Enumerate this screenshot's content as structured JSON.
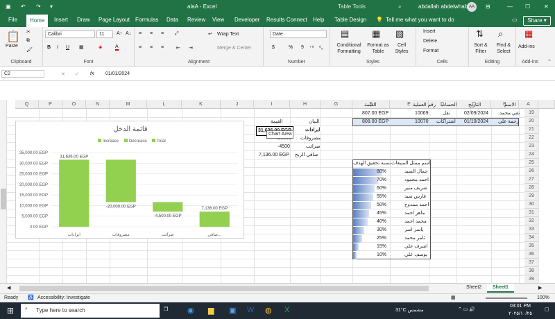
{
  "titlebar": {
    "file_name": "alaA",
    "app_name": "Excel",
    "context_tab": "Table Tools",
    "user_name": "abdallah abdelwhab",
    "user_initials": "AA",
    "save_label": "Save"
  },
  "tabs": [
    "File",
    "Home",
    "Insert",
    "Draw",
    "Page Layout",
    "Formulas",
    "Data",
    "Review",
    "View",
    "Developer",
    "Results Connect",
    "Help",
    "Table Design"
  ],
  "tell_me": "Tell me what you want to do",
  "share_label": "Share",
  "ribbon": {
    "clipboard": {
      "label": "Clipboard",
      "paste": "Paste"
    },
    "font": {
      "label": "Font",
      "name": "Calibri",
      "size": "11",
      "bold": "B",
      "italic": "I",
      "underline": "U"
    },
    "alignment": {
      "label": "Alignment",
      "wrap": "Wrap Text",
      "merge": "Merge & Center"
    },
    "number": {
      "label": "Number",
      "format": "Date",
      "currency": "$",
      "percent": "%",
      "comma": "9"
    },
    "styles": {
      "label": "Styles",
      "conditional": "Conditional Formatting",
      "format_table": "Format as Table",
      "cell_styles": "Cell Styles"
    },
    "cells": {
      "label": "Cells",
      "insert": "Insert",
      "delete": "Delete",
      "format": "Format"
    },
    "editing": {
      "label": "Editing",
      "sort": "Sort & Filter",
      "find": "Find & Select"
    },
    "addins": {
      "label": "Add-ins",
      "addins": "Add-ins"
    }
  },
  "formula_bar": {
    "name_box": "C2",
    "fx": "fx",
    "value": "01/01/2024"
  },
  "columns": [
    "Q",
    "P",
    "O",
    "N",
    "M",
    "L",
    "K",
    "J",
    "I",
    "H",
    "G",
    "F",
    "E",
    "D",
    "C",
    "B",
    "A"
  ],
  "rows": [
    "19",
    "20",
    "21",
    "22",
    "23",
    "24",
    "25",
    "26",
    "27",
    "28",
    "29",
    "30",
    "31",
    "32",
    "33",
    "34",
    "35",
    "36",
    "37",
    "38",
    "39"
  ],
  "table_header": {
    "name": "الاسم",
    "date": "التاريخ",
    "account": "الحساب",
    "op_no": "رقم العملية",
    "value": "القيمة"
  },
  "table_rows": [
    {
      "name": "تقي محمد",
      "date": "02/09/2024",
      "account": "نقل",
      "op_no": "10069",
      "value": "807.00 EGP"
    },
    {
      "name": "رحمة علي",
      "date": "01/10/2024",
      "account": "اشتراكات",
      "op_no": "10070",
      "value": "808.00 EGP"
    }
  ],
  "summary": {
    "header_item": "البيان",
    "header_value": "القيمة",
    "rows": [
      {
        "item": "ايرادات",
        "value": "31,636.00 EGP"
      },
      {
        "item": "مصروفات",
        "value": "-20000"
      },
      {
        "item": "ضرائب",
        "value": "-4500"
      },
      {
        "item": "صافي الربح",
        "value": "7,136.00 EGP"
      }
    ],
    "tooltip": "Chart Area"
  },
  "sales": {
    "header_name": "اسم ممثل المبيعات",
    "header_pct": "نسبة تحقيق الهدف",
    "rows": [
      {
        "name": "جمال السيد",
        "pct": "80%",
        "fill": 0.8
      },
      {
        "name": "احمد محمود",
        "pct": "70%",
        "fill": 0.7
      },
      {
        "name": "شريف منير",
        "pct": "60%",
        "fill": 0.6
      },
      {
        "name": "فارس سيد",
        "pct": "55%",
        "fill": 0.55
      },
      {
        "name": "احمد ممدوح",
        "pct": "50%",
        "fill": 0.5
      },
      {
        "name": "ماهر احمد",
        "pct": "45%",
        "fill": 0.45
      },
      {
        "name": "محمد احمد",
        "pct": "40%",
        "fill": 0.4
      },
      {
        "name": "ياسر اسر",
        "pct": "30%",
        "fill": 0.3
      },
      {
        "name": "ثامر محمد",
        "pct": "25%",
        "fill": 0.25
      },
      {
        "name": "اشرف علي",
        "pct": "15%",
        "fill": 0.15
      },
      {
        "name": "يوسف علي",
        "pct": "10%",
        "fill": 0.1
      }
    ]
  },
  "chart_data": {
    "type": "waterfall",
    "title": "قائمة الدخل",
    "legend": [
      "Increase",
      "Decrease",
      "Total"
    ],
    "legend_position": "top",
    "categories": [
      "ايرادات",
      "مصروفات",
      "ضرائب",
      "صافي..."
    ],
    "values": [
      31636,
      -20000,
      -4500,
      7136
    ],
    "data_labels": [
      "31,636.00 EGP",
      "-20,000.00 EGP",
      "-4,500.00 EGP",
      "7,136.00 EGP"
    ],
    "y_ticks": [
      "35,000.00 EGP",
      "30,000.00 EGP",
      "25,000.00 EGP",
      "20,000.00 EGP",
      "15,000.00 EGP",
      "10,000.00 EGP",
      "5,000.00 EGP",
      "0.00 EGP"
    ],
    "ylim": [
      0,
      35000
    ],
    "color": "#92d050",
    "grid": true
  },
  "sheet_tabs": [
    "Sheet2",
    "Sheet1"
  ],
  "active_sheet": "Sheet1",
  "status": {
    "ready": "Ready",
    "accessibility": "Accessibility: Investigate",
    "zoom": "100%"
  },
  "taskbar": {
    "search": "Type here to search",
    "weather": "31°C مشمس",
    "time": "03:01 PM",
    "date": "٢٠٢٥/١٠/٢٥"
  }
}
